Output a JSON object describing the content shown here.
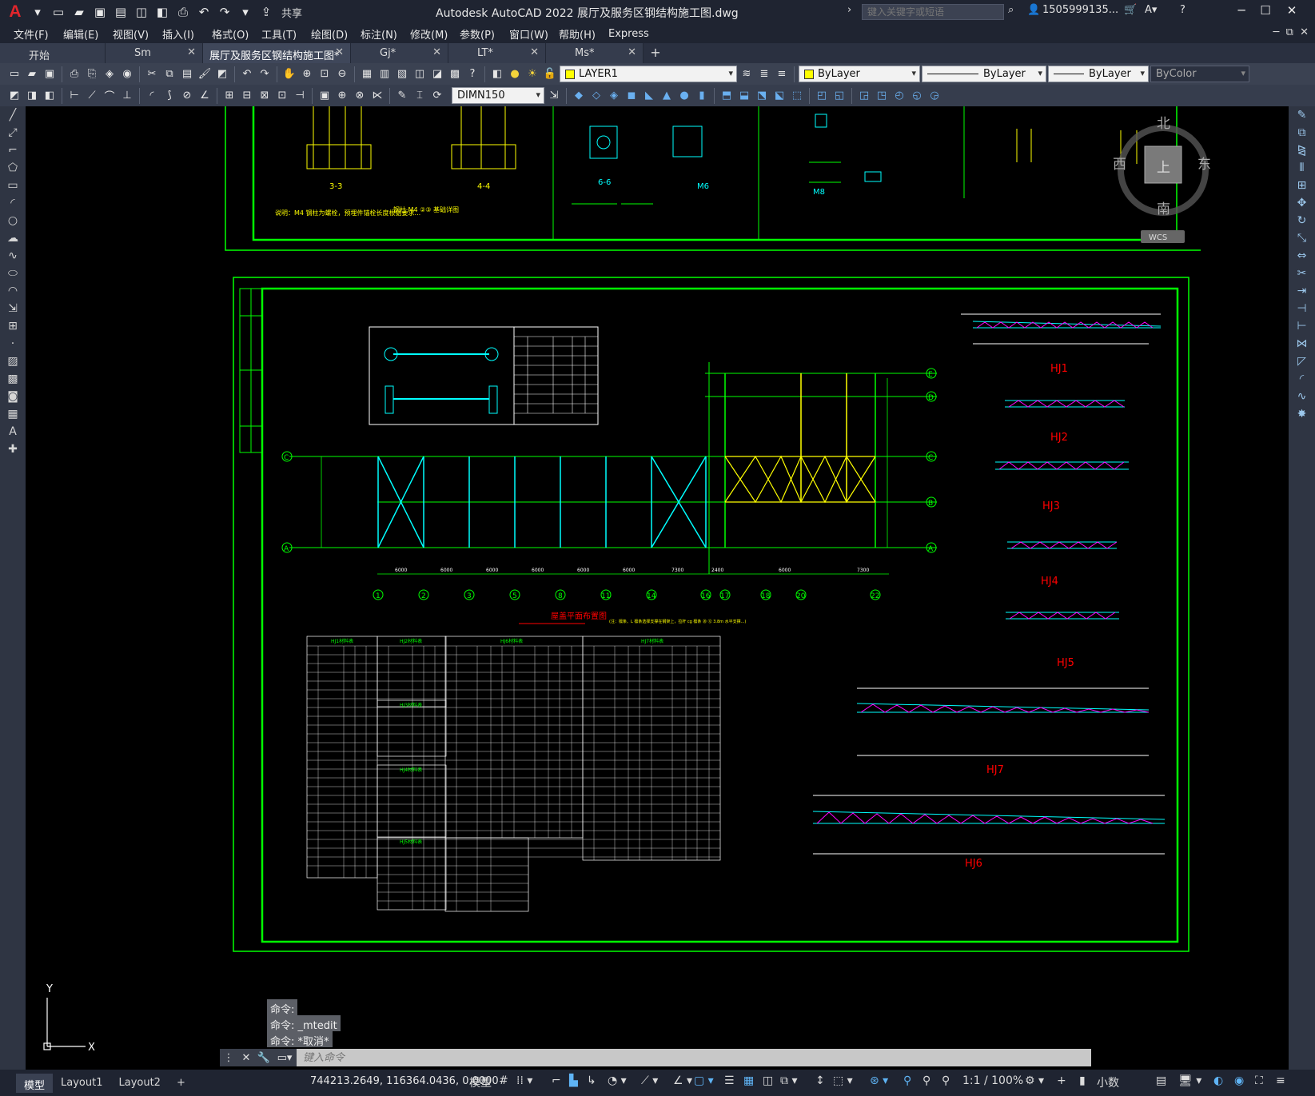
{
  "app": {
    "title": "Autodesk AutoCAD 2022    展厅及服务区钢结构施工图.dwg",
    "logo": "A",
    "share_label": "共享",
    "search_placeholder": "键入关键字或短语",
    "user": "1505999135...",
    "help": "?"
  },
  "menu": [
    "文件(F)",
    "编辑(E)",
    "视图(V)",
    "插入(I)",
    "格式(O)",
    "工具(T)",
    "绘图(D)",
    "标注(N)",
    "修改(M)",
    "参数(P)",
    "窗口(W)",
    "帮助(H)",
    "Express"
  ],
  "tabs": [
    {
      "label": "开始",
      "active": false
    },
    {
      "label": "Sm",
      "active": false
    },
    {
      "label": "展厅及服务区钢结构施工图*",
      "active": true
    },
    {
      "label": "Gj*",
      "active": false
    },
    {
      "label": "LT*",
      "active": false
    },
    {
      "label": "Ms*",
      "active": false
    }
  ],
  "toolbar": {
    "layer": "LAYER1",
    "color": "ByLayer",
    "linetype": "ByLayer",
    "lineweight": "ByLayer",
    "plotstyle": "ByColor",
    "dimstyle": "DIMN150"
  },
  "viewcube": {
    "north": "北",
    "south": "南",
    "east": "东",
    "west": "西",
    "top": "上",
    "wcs": "WCS"
  },
  "drawing": {
    "plan_title": "屋盖平面布置图",
    "plan_note": "(注：檩条、L 檩条选择支撑在钢架上，拉杆 cg 檩条 ⑳ ⑫ 3.8m 水平支撑...)",
    "truss_labels": [
      "HJ1",
      "HJ2",
      "HJ3",
      "HJ4",
      "HJ5",
      "HJ7",
      "HJ6"
    ],
    "section_labels": [
      "3-3",
      "4-4",
      "6-6",
      "M6",
      "M8"
    ],
    "grid_rows": [
      "E",
      "D",
      "C",
      "B",
      "A",
      "C",
      "A"
    ],
    "grid_cols": [
      "1",
      "2",
      "3",
      "5",
      "8",
      "11",
      "14",
      "16",
      "17",
      "18",
      "20",
      "22"
    ],
    "dims_bottom": [
      "6000",
      "6000",
      "6000",
      "6000",
      "6000",
      "6000",
      "7300",
      "2400",
      "6000",
      "7300"
    ],
    "table_titles": [
      "HJ1材料表",
      "HJ2材料表",
      "HJ3材料表",
      "HJ4材料表",
      "HJ5材料表",
      "HJ6材料表",
      "HJ7材料表"
    ],
    "upper_note": "说明：M4 钢柱为螺栓，预埋件锚栓长度根据要求...",
    "bottom_note": "钢柱 M4 ②③ 基础详图"
  },
  "command": {
    "history": [
      "命令:",
      "命令: _mtedit",
      "命令: *取消*"
    ],
    "placeholder": "键入命令"
  },
  "status": {
    "layouts": [
      "模型",
      "Layout1",
      "Layout2"
    ],
    "coords": "744213.2649, 116364.0436, 0.0000",
    "model": "模型",
    "scale": "1:1 / 100%",
    "units": "小数"
  },
  "colors": {
    "green": "#00ff00",
    "yellow": "#ffff00",
    "cyan": "#00ffff",
    "red": "#ff0000",
    "white": "#ffffff"
  }
}
